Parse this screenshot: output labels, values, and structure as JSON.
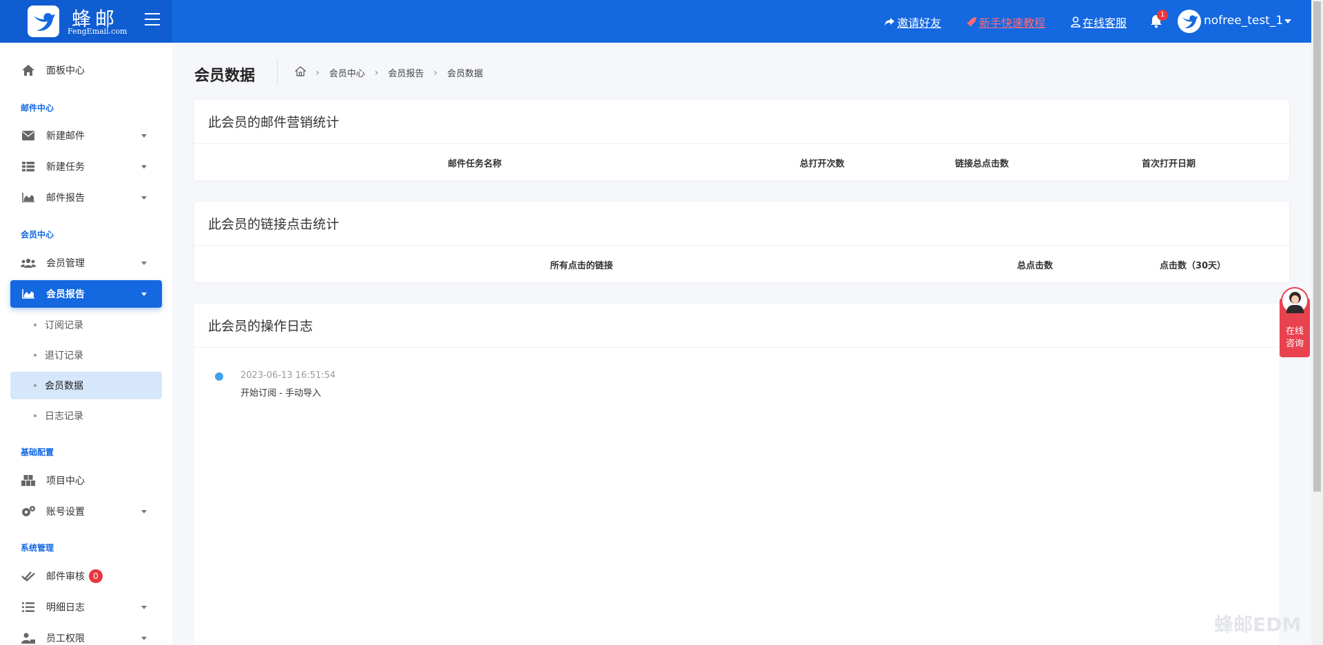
{
  "brand": {
    "name": "蜂邮",
    "subtitle": "FengEmail.com"
  },
  "topnav": {
    "invite": "邀请好友",
    "tutorial": "新手快速教程",
    "service": "在线客服",
    "notification_count": "1",
    "username": "nofree_test_1"
  },
  "sidebar": {
    "dashboard": "面板中心",
    "sections": {
      "mail_center": "邮件中心",
      "member_center": "会员中心",
      "basic_config": "基础配置",
      "system_admin": "系统管理"
    },
    "items": {
      "new_mail": "新建邮件",
      "new_task": "新建任务",
      "mail_report": "邮件报告",
      "member_manage": "会员管理",
      "member_report": "会员报告",
      "project_center": "项目中心",
      "account_settings": "账号设置",
      "mail_review": "邮件审核",
      "mail_review_count": "0",
      "detail_log": "明细日志",
      "staff_permission": "员工权限"
    },
    "sub_items": {
      "subscribe_records": "订阅记录",
      "unsubscribe_records": "退订记录",
      "member_data": "会员数据",
      "log_records": "日志记录"
    }
  },
  "page": {
    "title": "会员数据",
    "breadcrumb": [
      "会员中心",
      "会员报告",
      "会员数据"
    ]
  },
  "mail_stats": {
    "title": "此会员的邮件营销统计",
    "columns": [
      "邮件任务名称",
      "总打开次数",
      "链接总点击数",
      "首次打开日期"
    ]
  },
  "link_stats": {
    "title": "此会员的链接点击统计",
    "columns": [
      "所有点击的链接",
      "总点击数",
      "点击数（30天）"
    ]
  },
  "operation_log": {
    "title": "此会员的操作日志",
    "entries": [
      {
        "time": "2023-06-13 16:51:54",
        "text": "开始订阅 - 手动导入"
      }
    ]
  },
  "float_service": {
    "line1": "在线",
    "line2": "咨询"
  },
  "watermark": "蜂邮EDM",
  "colors": {
    "primary": "#1468e0",
    "danger": "#e8363f",
    "tutorial": "#ff6b7a"
  }
}
